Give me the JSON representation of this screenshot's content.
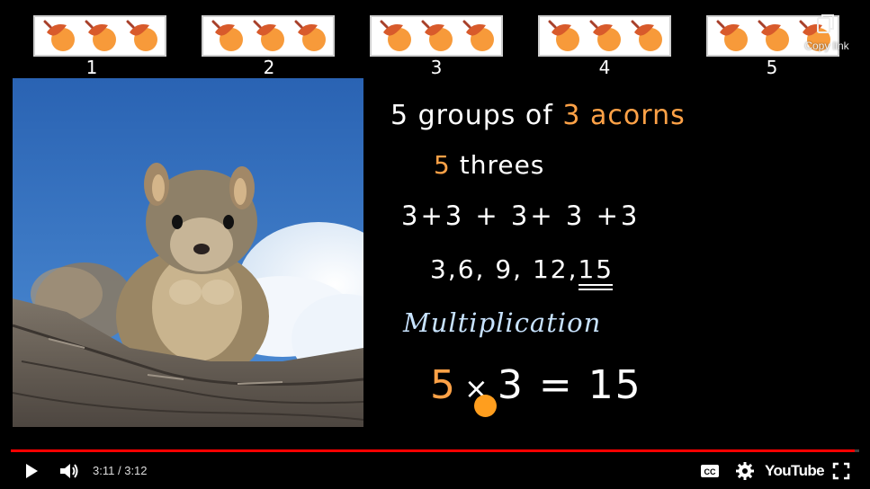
{
  "video": {
    "groups": [
      {
        "label": "1",
        "acorns": 3
      },
      {
        "label": "2",
        "acorns": 3
      },
      {
        "label": "3",
        "acorns": 3
      },
      {
        "label": "4",
        "acorns": 3
      },
      {
        "label": "5",
        "acorns": 3
      }
    ],
    "copy_link_label": "Copy link",
    "notes": {
      "line1_count": "5",
      "line1_text": "groups of",
      "line1_num": "3",
      "line1_noun": "acorns",
      "line2_count": "5",
      "line2_text": "threes",
      "line3": "3+3 + 3+ 3 +3",
      "line4_prefix": "3,6, 9, 12,",
      "line4_last": "15",
      "line5": "Multiplication",
      "line6_a": "5",
      "line6_times": "×",
      "line6_b": "3",
      "line6_eq": "=",
      "line6_result": "15"
    }
  },
  "player": {
    "current_time": "3:11",
    "separator": "/",
    "duration": "3:12",
    "progress_fraction": 0.995,
    "youtube_label": "YouTube",
    "buttons": {
      "play": "play-icon",
      "volume": "volume-icon",
      "captions": "cc-icon",
      "settings": "gear-icon",
      "fullscreen": "fullscreen-icon"
    },
    "colors": {
      "progress": "#ff0000",
      "accent_orange": "#ffa247",
      "multiplication_blue": "#c8e3ff"
    }
  }
}
